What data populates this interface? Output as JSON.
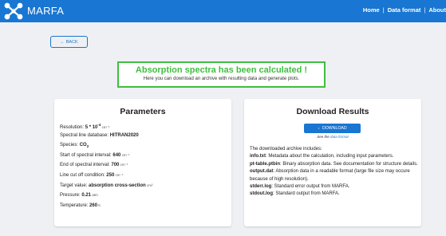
{
  "header": {
    "brand": "MARFA",
    "nav": [
      "Home",
      "Data format",
      "About"
    ],
    "separator": "|",
    "accent_color": "#1976d2"
  },
  "back_button": {
    "icon": "arrow-left-icon",
    "label": "BACK"
  },
  "banner": {
    "title": "Absorption spectra has been calculated !",
    "subtitle": "Here you can download an archive with resulting data and generate plots.",
    "color": "#3fbf3f"
  },
  "parameters": {
    "title": "Parameters",
    "resolution": {
      "label": "Resolution: ",
      "mantissa": "5",
      "times": " * ",
      "base": "10",
      "exponent": "-4",
      "unit": " cm⁻¹"
    },
    "database": {
      "label": "Spectral line database: ",
      "value": "HITRAN2020"
    },
    "species": {
      "label": "Species: ",
      "value": "CO",
      "subscript": "2"
    },
    "start": {
      "label": "Start of spectral interval: ",
      "value": "640",
      "unit": " cm⁻¹"
    },
    "end": {
      "label": "End of spectral interval: ",
      "value": "700",
      "unit": " cm⁻¹"
    },
    "cutoff": {
      "label": "Line cut off condition: ",
      "value": "250",
      "unit": " cm⁻¹"
    },
    "target": {
      "label": "Target value: ",
      "value": "absorption cross-section",
      "unit": " cm²"
    },
    "pressure": {
      "label": "Pressure: ",
      "value": "0.21",
      "unit": " atm"
    },
    "temperature": {
      "label": "Temperature: ",
      "value": "260",
      "unit": " K"
    }
  },
  "download": {
    "title": "Download Results",
    "button_label": "DOWNLOAD",
    "button_icon": "download-arrow-icon",
    "see_prefix": "See the ",
    "see_link": "data format",
    "intro": "The downloaded archive includes:",
    "files": [
      {
        "name": "info.txt",
        "desc": ": Metadata about the calculation, including input parameters."
      },
      {
        "name": "pt-table.ptbin",
        "desc": ": Binary absorption data. See documentation for structure details."
      },
      {
        "name": "output.dat",
        "desc": ": Absorption data in a readable format (large file size may occure because of high resolution)."
      },
      {
        "name": "stderr.log",
        "desc": ": Standard error output from MARFA."
      },
      {
        "name": "stdout.log",
        "desc": ": Standard output from MARFA."
      }
    ]
  }
}
